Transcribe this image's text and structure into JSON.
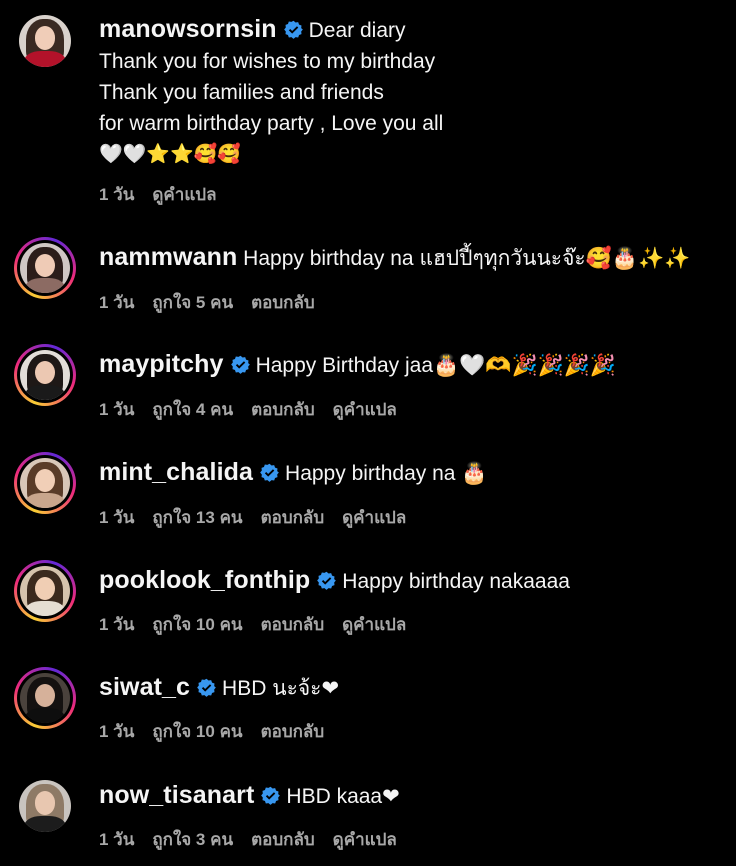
{
  "comments": [
    {
      "username": "manowsornsin",
      "verified": true,
      "lines": [
        "Dear diary",
        "Thank you for wishes to my birthday",
        "Thank you families and friends",
        "for warm birthday party , Love you all",
        "🤍🤍⭐⭐🥰🥰"
      ],
      "meta": {
        "time": "1 วัน",
        "translate": "ดูคำแปล"
      }
    },
    {
      "username": "nammwann",
      "verified": false,
      "text": "Happy birthday na แฮปปี้ๆทุกวันนะจ๊ะ🥰🎂✨✨",
      "meta": {
        "time": "1 วัน",
        "likes": "ถูกใจ 5 คน",
        "reply": "ตอบกลับ"
      }
    },
    {
      "username": "maypitchy",
      "verified": true,
      "text": "Happy Birthday jaa🎂🤍🫶🎉🎉🎉🎉",
      "meta": {
        "time": "1 วัน",
        "likes": "ถูกใจ 4 คน",
        "reply": "ตอบกลับ",
        "translate": "ดูคำแปล"
      }
    },
    {
      "username": "mint_chalida",
      "verified": true,
      "text": "Happy birthday na 🎂",
      "meta": {
        "time": "1 วัน",
        "likes": "ถูกใจ 13 คน",
        "reply": "ตอบกลับ",
        "translate": "ดูคำแปล"
      }
    },
    {
      "username": "pooklook_fonthip",
      "verified": true,
      "text": "Happy birthday nakaaaa",
      "meta": {
        "time": "1 วัน",
        "likes": "ถูกใจ 10 คน",
        "reply": "ตอบกลับ",
        "translate": "ดูคำแปล"
      }
    },
    {
      "username": "siwat_c",
      "verified": true,
      "text": "HBD นะจ้ะ❤",
      "meta": {
        "time": "1 วัน",
        "likes": "ถูกใจ 10 คน",
        "reply": "ตอบกลับ"
      }
    },
    {
      "username": "now_tisanart",
      "verified": true,
      "text": "HBD kaaa❤",
      "meta": {
        "time": "1 วัน",
        "likes": "ถูกใจ 3 คน",
        "reply": "ตอบกลับ",
        "translate": "ดูคำแปล"
      }
    }
  ],
  "colors": {
    "background": "#000000",
    "text": "#f5f5f5",
    "meta": "#a8a8a8",
    "verified": "#3897f0"
  }
}
